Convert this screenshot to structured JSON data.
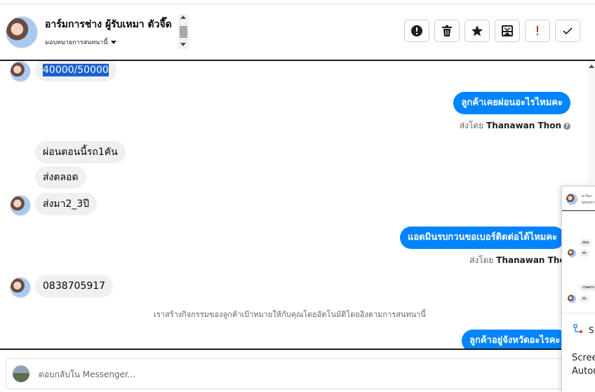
{
  "header": {
    "contact_name": "อาร์มการช่าง ผู้รับเหมา ตัวจี๊ด",
    "assign_label": "มอบหมายการสนทนานี้",
    "actions": [
      {
        "icon": "exclamation-circle-icon",
        "label": "Report"
      },
      {
        "icon": "trash-icon",
        "label": "Delete"
      },
      {
        "icon": "star-icon",
        "label": "Star"
      },
      {
        "icon": "mail-archive-icon",
        "label": "Move"
      },
      {
        "icon": "red-exclamation-icon",
        "label": "Spam"
      },
      {
        "icon": "check-icon",
        "label": "Done"
      }
    ]
  },
  "messages": {
    "m1": "40000/50000",
    "m2": "ลูกค้าเคยผ่อนอะไรไหมคะ",
    "sent_prefix": "ส่งโดย",
    "sent_agent": "Thanawan Thon",
    "m3": "ผ่อนตอนนี้รถ1คัน",
    "m4": "ส่งตลอด",
    "m5": "ส่งมา2_3ปี",
    "m6": "แอดมินรบกวนขอเบอร์ติดต่อได้ไหมคะ",
    "m7": "0838705917",
    "notice": "เราสร้างกิจกรรมของลูกค้าเป้าหมายให้กับคุณโดยอัตโนมัติโดยอิงตามการสนทนานี้",
    "m8": "ลูกค้าอยู่จังหวัดอะไรคะ"
  },
  "composer": {
    "placeholder": "ตอบกลับใน Messenger..."
  },
  "popup": {
    "header_name": "อาร์มก",
    "header_sub": "มอบหมาย",
    "bubble1": "ผ่อน",
    "bubble2": "ส่ง",
    "bubble3": "เกษตรก",
    "bubble4": "ส่ง",
    "section_label": "S",
    "line1": "Scree",
    "line2": "Autor"
  },
  "colors": {
    "outgoing_bubble": "#0084ff",
    "incoming_bubble": "#f0f0f0",
    "selection": "#1a5fcf",
    "danger": "#e02020"
  }
}
